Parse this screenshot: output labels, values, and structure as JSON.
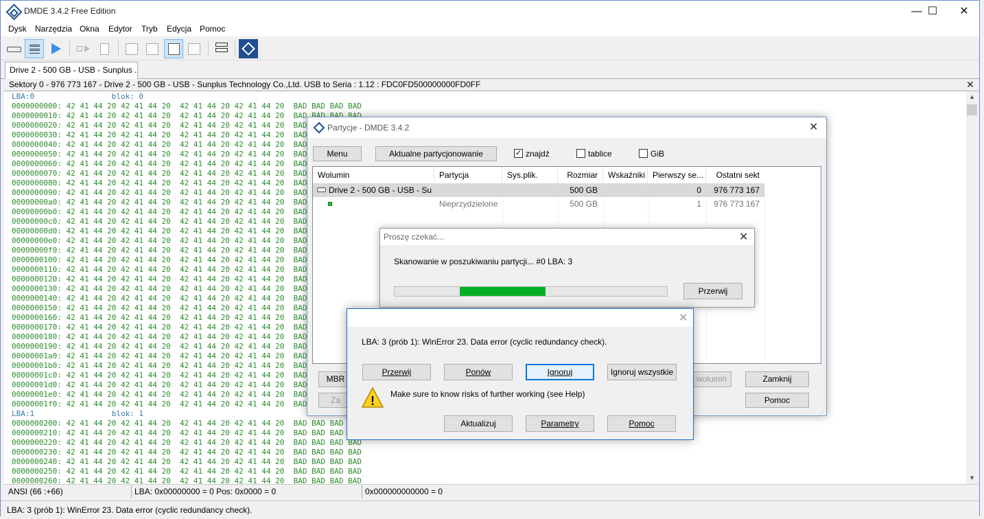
{
  "app": {
    "title": "DMDE 3.4.2 Free Edition",
    "controls": {
      "minimize": "—",
      "maximize": "☐",
      "close": "✕"
    }
  },
  "menu": [
    "Dysk",
    "Narzędzia",
    "Okna",
    "Edytor",
    "Tryb",
    "Edycja",
    "Pomoc"
  ],
  "toolbar_icons": [
    "drive-icon",
    "list-view-icon",
    "play-icon",
    "step-icon",
    "new-file-icon",
    "table-view-icon",
    "list-grid-icon",
    "hex-view-icon",
    "search-view-icon",
    "partitions-icon",
    "dmde-logo-icon"
  ],
  "tab": {
    "label": "Drive 2 - 500 GB - USB - Sunplus ..."
  },
  "sector_header": {
    "text": "Sektory 0 - 976 773 167 - Drive 2 - 500 GB - USB - Sunplus Technology Co.,Ltd. USB to Seria : 1.12 : FDC0FD500000000FD0FF",
    "close": "✕"
  },
  "hex": {
    "lba0_label": "LBA:0",
    "blok0_label": "blok: 0",
    "lba1_label": "LBA:1",
    "blok1_label": "blok: 1",
    "hex_bytes": "42 41 44 20 42 41 44 20  42 41 44 20 42 41 44 20",
    "ascii": "BAD BAD BAD BAD",
    "offsets_block0": [
      "0000000000",
      "0000000010",
      "0000000020",
      "0000000030",
      "0000000040",
      "0000000050",
      "0000000060",
      "0000000070",
      "0000000080",
      "0000000090",
      "00000000a0",
      "00000000b0",
      "00000000c0",
      "00000000d0",
      "00000000e0",
      "00000000f0",
      "0000000100",
      "0000000110",
      "0000000120",
      "0000000130",
      "0000000140",
      "0000000150",
      "0000000160",
      "0000000170",
      "0000000180",
      "0000000190",
      "00000001a0",
      "00000001b0",
      "00000001c0",
      "00000001d0",
      "00000001e0",
      "00000001f0"
    ],
    "offsets_block1": [
      "0000000200",
      "0000000210",
      "0000000220",
      "0000000230",
      "0000000240",
      "0000000250",
      "0000000260"
    ]
  },
  "status": {
    "encoding": "ANSI (66 :+66)",
    "position": "LBA: 0x00000000 = 0  Pos: 0x0000 = 0",
    "value": "0x000000000000 = 0",
    "message": "LBA: 3 (prób 1): WinError 23. Data error (cyclic redundancy check)."
  },
  "partitions_dialog": {
    "title": "Partycje - DMDE 3.4.2",
    "menu_button": "Menu",
    "current_partitioning_button": "Aktualne partycjonowanie",
    "checkboxes": [
      {
        "label": "znajdź",
        "checked": true
      },
      {
        "label": "tablice",
        "checked": false
      },
      {
        "label": "GiB",
        "checked": false
      }
    ],
    "columns": [
      "Wolumin",
      "Partycja",
      "Sys.plik.",
      "Rozmiar",
      "Wskaźniki",
      "Pierwszy se...",
      "Ostatni sekt"
    ],
    "rows": [
      {
        "volume": "Drive 2 - 500 GB - USB - Su...",
        "partition": "",
        "fs": "",
        "size": "500 GB",
        "flags": "",
        "first": "0",
        "last": "976 773 167",
        "selected": true
      },
      {
        "volume": "",
        "partition": "Nieprzydzielone",
        "fs": "",
        "size": "500 GB",
        "flags": "",
        "first": "1",
        "last": "976 773 167",
        "selected": false
      }
    ],
    "bottom_buttons": {
      "mbr": "MBR",
      "za": "Za",
      "volume": "wolumin",
      "close": "Zamknij",
      "help": "Pomoc"
    }
  },
  "wait_dialog": {
    "title": "Proszę czekać...",
    "message": "Skanowanie w poszukiwaniu partycji...  #0  LBA: 3",
    "progress": {
      "start": 0.24,
      "end": 0.555
    },
    "abort_button": "Przerwij"
  },
  "error_dialog": {
    "message": "LBA: 3 (prób 1): WinError 23. Data error (cyclic redundancy check).",
    "buttons": [
      "Przerwij",
      "Ponów",
      "Ignoruj",
      "Ignoruj wszystkie"
    ],
    "warning": "Make sure to know risks of further working (see Help)",
    "bottom_buttons": [
      "Aktualizuj",
      "Parametry",
      "Pomoc"
    ],
    "warning_mark": "!"
  },
  "colors": {
    "hex_green": "#2e8b2e",
    "lba_blue": "#3a7ba8",
    "accent": "#0078d7",
    "progress": "#06b025"
  }
}
